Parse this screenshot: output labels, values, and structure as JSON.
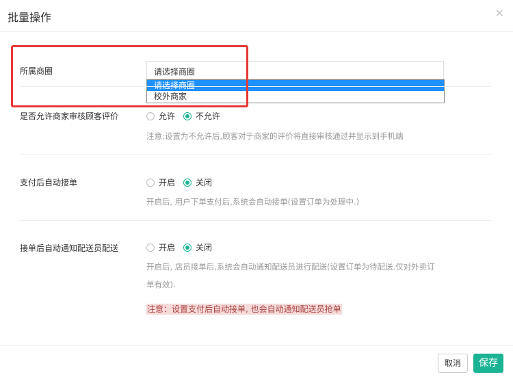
{
  "dialog": {
    "title": "批量操作",
    "close_glyph": "×"
  },
  "area": {
    "label": "所属商圈",
    "selected": "请选择商圈",
    "options": [
      "请选择商圈",
      "校外商家"
    ]
  },
  "review": {
    "label": "是否允许商家审核顾客评价",
    "options": [
      "允许",
      "不允许"
    ],
    "selected": "不允许",
    "hint": "注意:设置为不允许后,顾客对于商家的评价将直接审核通过并显示到手机端"
  },
  "auto_accept": {
    "label": "支付后自动接单",
    "options": [
      "开启",
      "关闭"
    ],
    "selected": "关闭",
    "hint": "开启后, 用户下单支付后,系统会自动接单(设置订单为处理中.)"
  },
  "auto_notify": {
    "label": "接单后自动通知配送员配送",
    "options": [
      "开启",
      "关闭"
    ],
    "selected": "关闭",
    "hint_line1": "开启后, 店员接单后,系统会自动通知配送员进行配送(设置订单为待配送.仅对外卖订",
    "hint_line2": "单有效).",
    "warning": "注意：设置支付后自动接单, 也会自动通知配送员抢单"
  },
  "footer": {
    "cancel_label": "取消",
    "ok_label": "保存"
  },
  "colors": {
    "accent": "#1ab394",
    "highlight_box": "#e53935",
    "option_selected": "#1e90ff"
  }
}
